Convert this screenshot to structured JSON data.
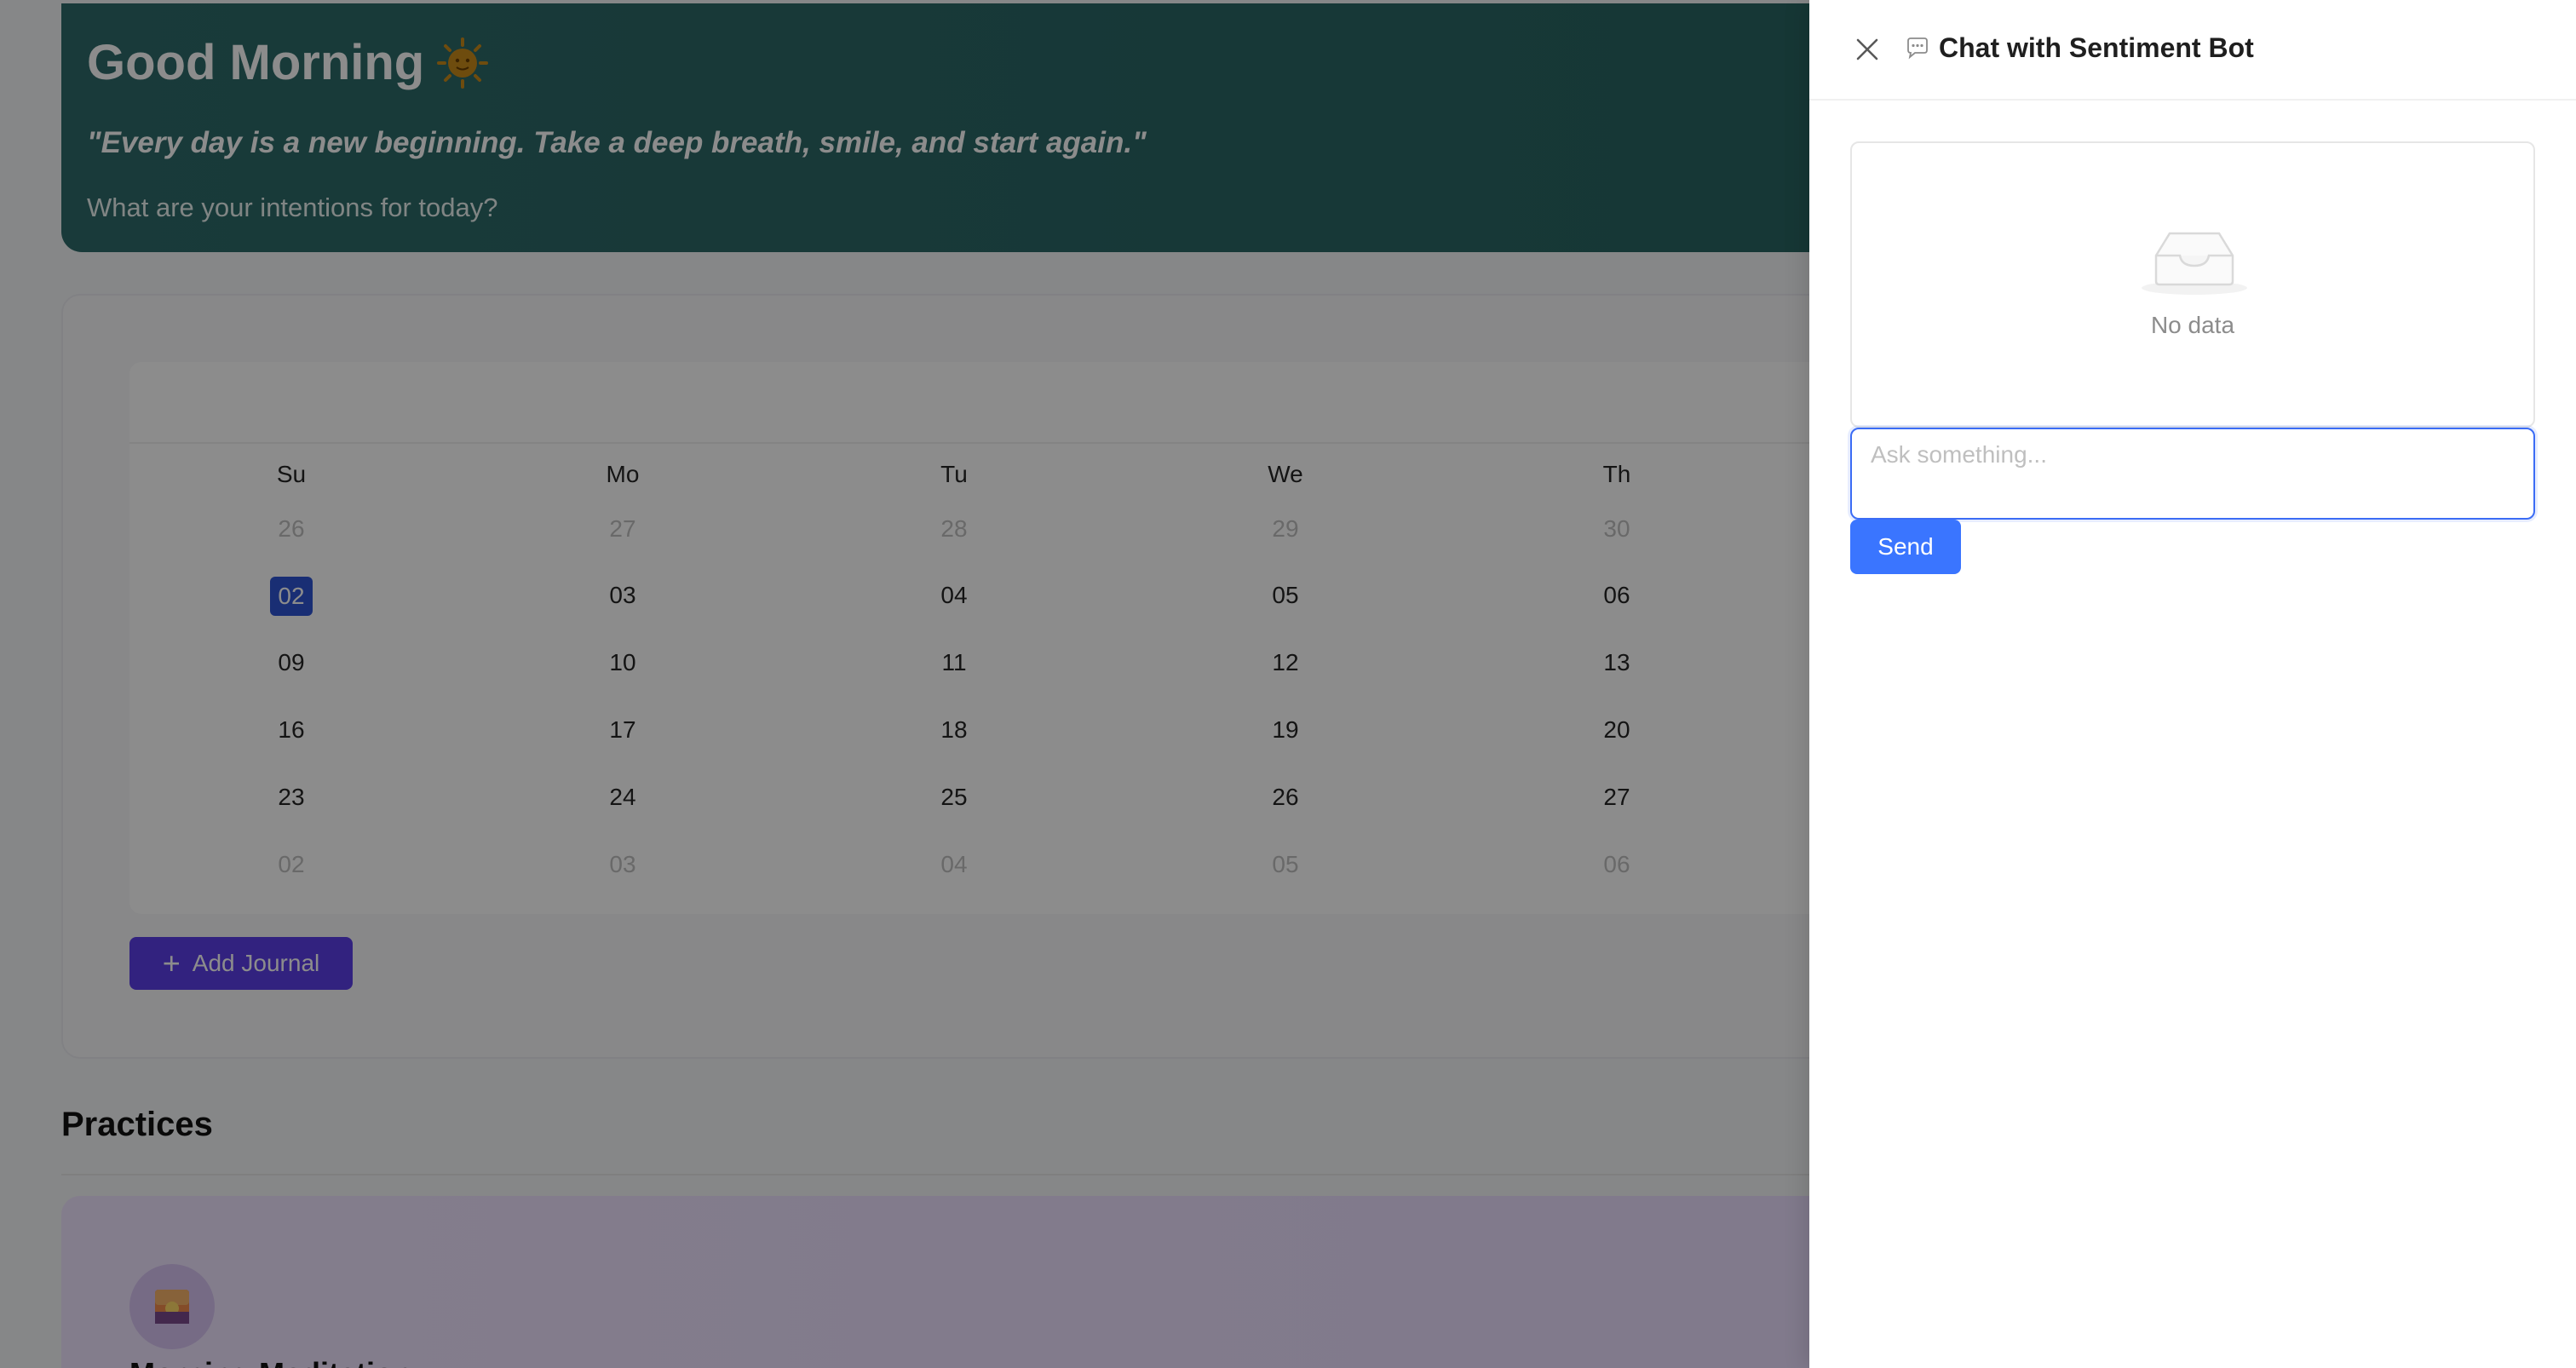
{
  "hero": {
    "greeting": "Good Morning",
    "greeting_icon": "sun-face-icon",
    "quote": "\"Every day is a new beginning. Take a deep breath, smile, and start again.\"",
    "prompt": "What are your intentions for today?"
  },
  "calendar": {
    "weekdays": [
      "Su",
      "Mo",
      "Tu",
      "We",
      "Th"
    ],
    "weeks": [
      [
        "26",
        "27",
        "28",
        "29",
        "30"
      ],
      [
        "02",
        "03",
        "04",
        "05",
        "06"
      ],
      [
        "09",
        "10",
        "11",
        "12",
        "13"
      ],
      [
        "16",
        "17",
        "18",
        "19",
        "20"
      ],
      [
        "23",
        "24",
        "25",
        "26",
        "27"
      ],
      [
        "02",
        "03",
        "04",
        "05",
        "06"
      ]
    ],
    "selected_day": "02",
    "add_journal_label": "Add Journal"
  },
  "practices": {
    "title": "Practices",
    "first_item": "Morning Meditation"
  },
  "drawer": {
    "title": "Chat with Sentiment Bot",
    "empty_text": "No data",
    "input_placeholder": "Ask something...",
    "input_value": "",
    "send_label": "Send"
  },
  "colors": {
    "hero_bg": "#2e6b6a",
    "selected_day_bg": "#2f55d4",
    "add_journal_bg": "#5b3ee8",
    "send_bg": "#3a75ff",
    "input_focus_border": "#3b6cf5"
  }
}
